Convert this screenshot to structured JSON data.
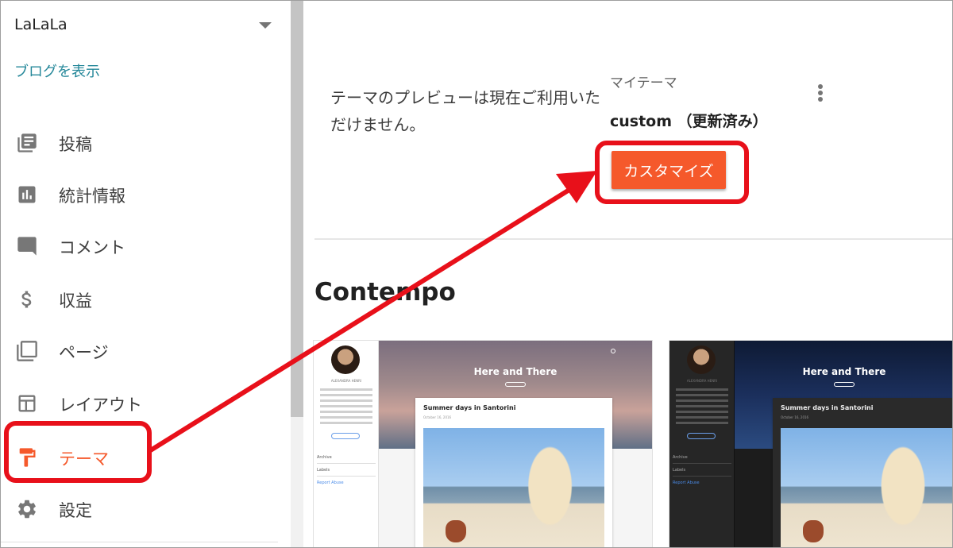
{
  "sidebar": {
    "blog_name": "LaLaLa",
    "view_blog_link": "ブログを表示",
    "items": [
      {
        "label": "投稿",
        "icon": "posts-icon"
      },
      {
        "label": "統計情報",
        "icon": "stats-icon"
      },
      {
        "label": "コメント",
        "icon": "comment-icon"
      },
      {
        "label": "収益",
        "icon": "dollar-icon"
      },
      {
        "label": "ページ",
        "icon": "pages-icon"
      },
      {
        "label": "レイアウト",
        "icon": "layout-icon"
      },
      {
        "label": "テーマ",
        "icon": "theme-roller-icon",
        "active": true
      },
      {
        "label": "設定",
        "icon": "gear-icon"
      }
    ]
  },
  "main": {
    "preview_unavailable": "テーマのプレビューは現在ご利用いただけません。",
    "my_theme_label": "マイテーマ",
    "current_theme": "custom （更新済み）",
    "customize_button": "カスタマイズ",
    "section_title": "Contempo",
    "thumbnails": [
      {
        "variant": "light",
        "blog_title": "Here and There",
        "post_title": "Summer days in Santorini",
        "post_date": "October 16, 2016",
        "author": "ALEXANDRA HENRI",
        "menu_archive": "Archive",
        "menu_labels": "Labels",
        "report_abuse": "Report Abuse"
      },
      {
        "variant": "dark",
        "blog_title": "Here and There",
        "post_title": "Summer days in Santorini",
        "post_date": "October 16, 2016",
        "author": "ALEXANDRA HENRI",
        "menu_archive": "Archive",
        "menu_labels": "Labels",
        "report_abuse": "Report Abuse"
      }
    ]
  },
  "colors": {
    "accent": "#f5592b",
    "link": "#26889a",
    "annotation": "#e8101a"
  }
}
